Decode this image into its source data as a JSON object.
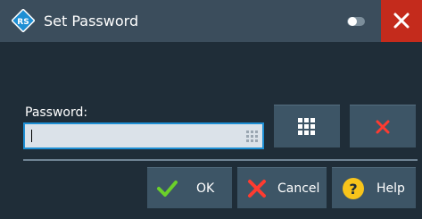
{
  "window": {
    "title": "Set Password",
    "logo_icon": "rohde-schwarz-logo-icon",
    "toggle_icon": "toggle-icon",
    "close_icon": "close-icon"
  },
  "form": {
    "password_label": "Password:",
    "password_value": "",
    "input_keypad_icon": "keypad-icon"
  },
  "side_buttons": {
    "keypad_icon": "keypad-icon",
    "clear_icon": "clear-icon"
  },
  "buttons": {
    "ok_label": "OK",
    "cancel_label": "Cancel",
    "help_label": "Help"
  },
  "colors": {
    "background": "#1f2d38",
    "titlebar": "#3b4d5c",
    "close_button": "#c42b1c",
    "button": "#3d5566",
    "accent_blue": "#1e8fd4",
    "ok_green": "#6bd12a",
    "cancel_red": "#ff3b30",
    "help_yellow": "#f8c41a"
  }
}
